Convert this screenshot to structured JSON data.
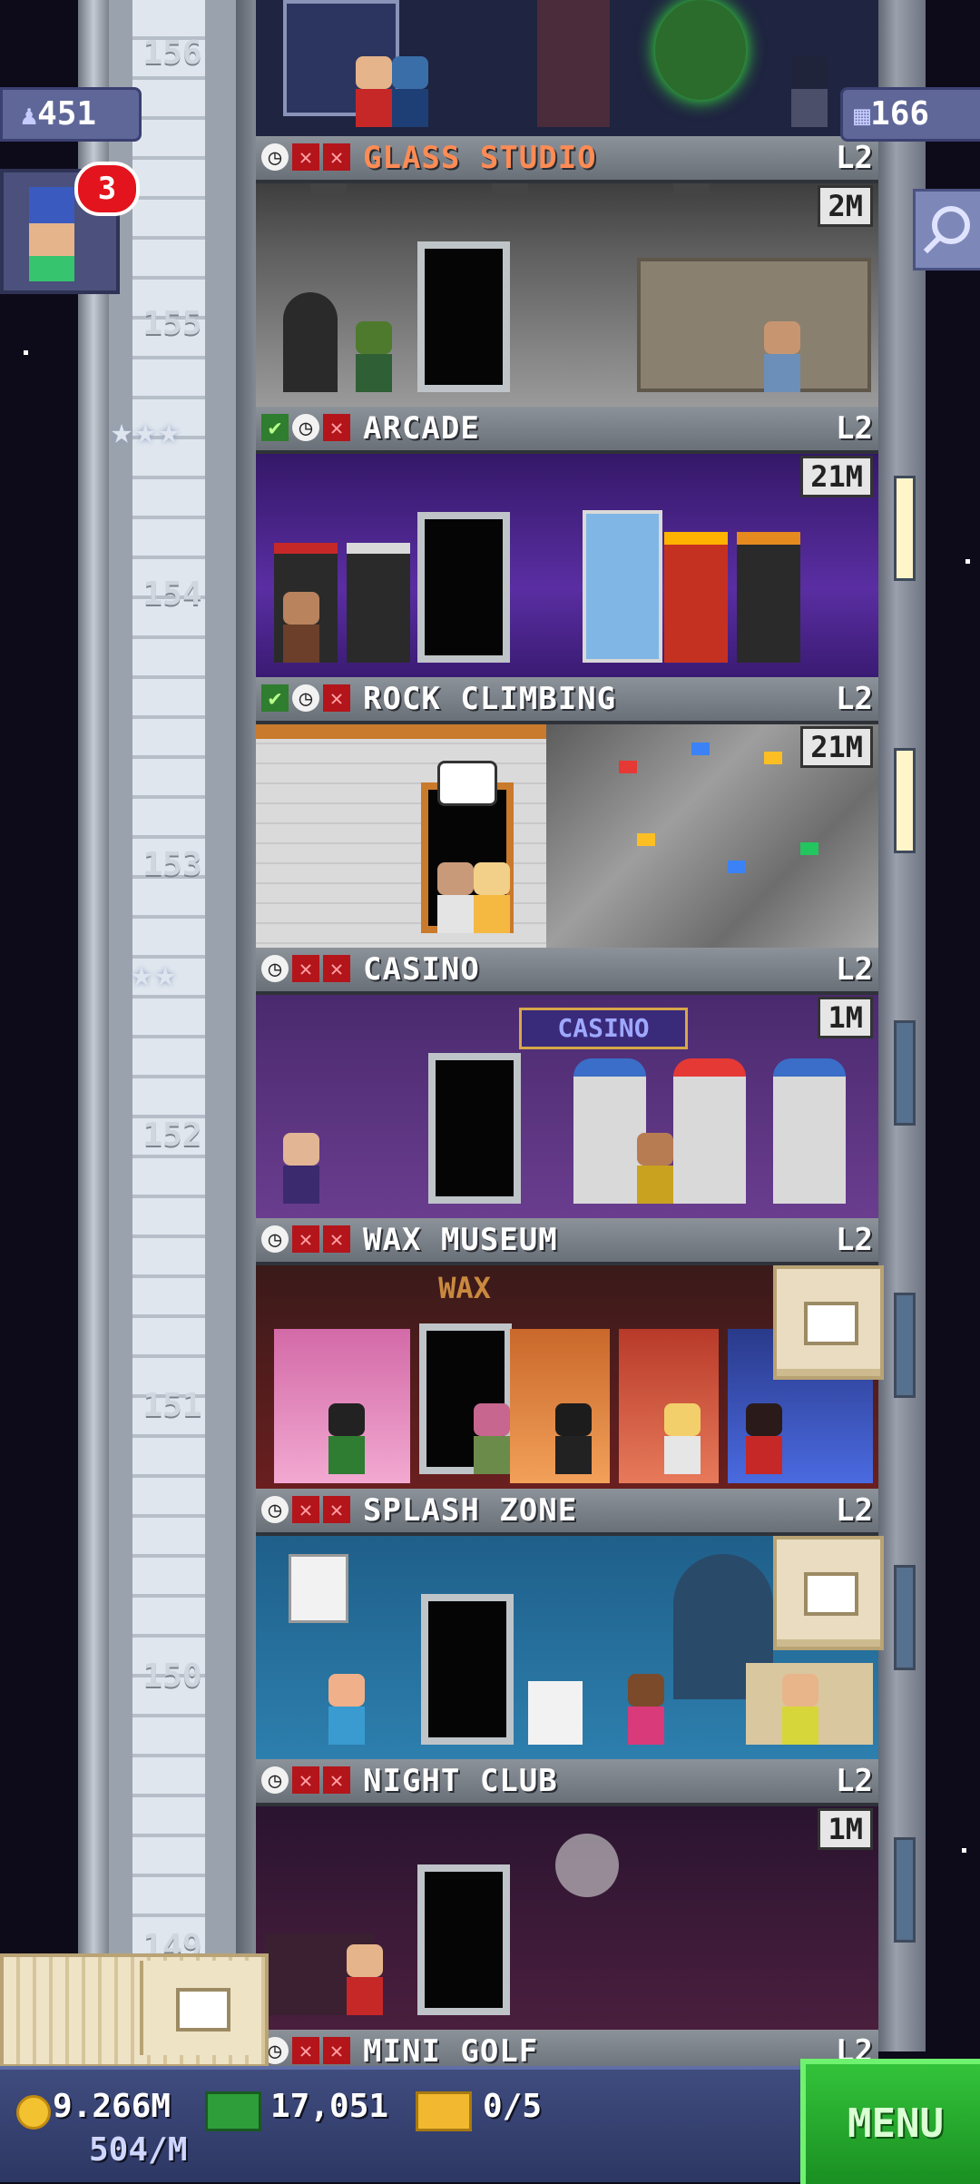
{
  "top_bar": {
    "population": "451",
    "stories": "166",
    "notification_count": "3"
  },
  "floor_numbers": [
    "156",
    "155",
    "154",
    "153",
    "152",
    "151",
    "150",
    "149"
  ],
  "floors": [
    {
      "name": "GLASS STUDIO",
      "level": "L2",
      "population": "2M",
      "status": [
        "clock",
        "x",
        "x"
      ],
      "building": true
    },
    {
      "name": "ARCADE",
      "level": "L2",
      "population": "21M",
      "status": [
        "check",
        "clock",
        "x"
      ],
      "building": false
    },
    {
      "name": "ROCK CLIMBING",
      "level": "L2",
      "population": "21M",
      "status": [
        "check",
        "clock",
        "x"
      ],
      "building": false
    },
    {
      "name": "CASINO",
      "level": "L2",
      "population": "1M",
      "status": [
        "clock",
        "x",
        "x"
      ],
      "building": false
    },
    {
      "name": "WAX MUSEUM",
      "level": "L2",
      "population": "",
      "status": [
        "clock",
        "x",
        "x"
      ],
      "building": false
    },
    {
      "name": "SPLASH ZONE",
      "level": "L2",
      "population": "",
      "status": [
        "clock",
        "x",
        "x"
      ],
      "building": false
    },
    {
      "name": "NIGHT CLUB",
      "level": "L2",
      "population": "1M",
      "status": [
        "clock",
        "x",
        "x"
      ],
      "building": false
    },
    {
      "name": "MINI GOLF",
      "level": "L2",
      "population": "",
      "status": [
        "clock",
        "x",
        "x"
      ],
      "building": false
    }
  ],
  "signs": {
    "casino": "CASINO",
    "wax": "WAX"
  },
  "ratings": {
    "arcade": "★★★",
    "casino": "★★"
  },
  "bottom_bar": {
    "coins": "9.266M",
    "income": "504/M",
    "bux": "17,051",
    "tickets": "0/5",
    "menu_label": "MENU"
  },
  "colors": {
    "building_text": "#ff8b55",
    "menu_green": "#2fb635",
    "bar_blue": "#3a467a"
  }
}
